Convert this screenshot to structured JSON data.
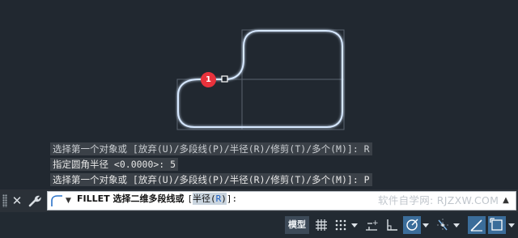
{
  "canvas": {
    "marker_label": "1"
  },
  "command_history": [
    "选择第一个对象或 [放弃(U)/多段线(P)/半径(R)/修剪(T)/多个(M)]: R",
    "指定圆角半径 <0.0000>: 5",
    "选择第一个对象或 [放弃(U)/多段线(P)/半径(R)/修剪(T)/多个(M)]: P"
  ],
  "command_line": {
    "command": "FILLET",
    "prompt": "选择二维多段线或 ",
    "option_open": "[",
    "option_label": "半径",
    "option_key_open": "(",
    "option_key": "R",
    "option_key_close": ")",
    "option_close": "]:",
    "watermark": "软件自学网: RJZXW.COM"
  },
  "status_bar": {
    "model_label": "模型",
    "icons": [
      "grid-icon",
      "snap-icon",
      "infer-constraints-icon",
      "ortho-icon",
      "polar-tracking-icon",
      "object-snap-tracking-icon",
      "lineweight-icon",
      "selection-cycling-icon"
    ]
  },
  "colors": {
    "canvas_bg": "#212830",
    "polyline": "#cfe3ff",
    "marker": "#e8323c",
    "active_toggle": "#3b6d9a"
  }
}
